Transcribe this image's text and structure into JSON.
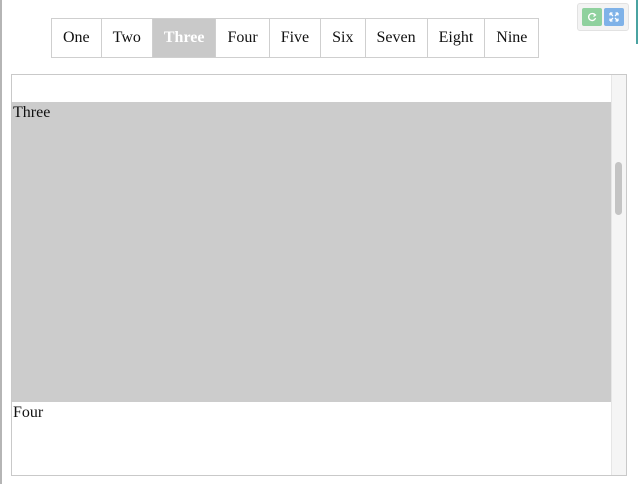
{
  "tabs": [
    {
      "label": "One"
    },
    {
      "label": "Two"
    },
    {
      "label": "Three"
    },
    {
      "label": "Four"
    },
    {
      "label": "Five"
    },
    {
      "label": "Six"
    },
    {
      "label": "Seven"
    },
    {
      "label": "Eight"
    },
    {
      "label": "Nine"
    }
  ],
  "active_tab": "Three",
  "toolbar": {
    "refresh_icon": "refresh-icon",
    "expand_icon": "expand-icon"
  },
  "panel": {
    "sections": [
      {
        "label": "Three"
      },
      {
        "label": "Four"
      }
    ]
  },
  "colors": {
    "active_tab_bg": "#c9c9c9",
    "section_highlight_bg": "#cccccc",
    "refresh_button": "#8fd19e",
    "expand_button": "#7fb2e8"
  }
}
